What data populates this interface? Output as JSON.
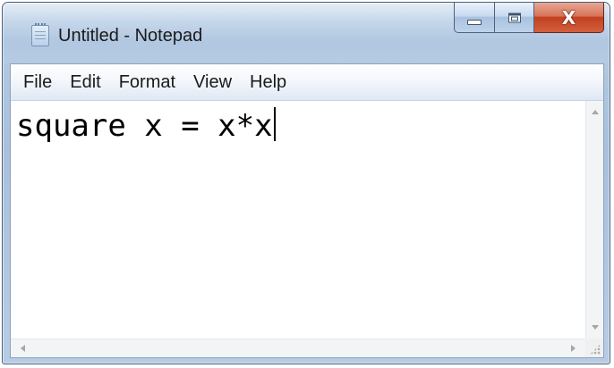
{
  "window": {
    "title": "Untitled - Notepad",
    "app_icon": "notepad-icon",
    "controls": {
      "minimize_icon": "minimize-icon",
      "maximize_icon": "maximize-icon",
      "close_glyph": "X"
    }
  },
  "menu": {
    "items": [
      {
        "label": "File"
      },
      {
        "label": "Edit"
      },
      {
        "label": "Format"
      },
      {
        "label": "View"
      },
      {
        "label": "Help"
      }
    ]
  },
  "editor": {
    "content": "square x = x*x"
  },
  "colors": {
    "titlebar": "#b3c9e2",
    "close_button": "#c2401f",
    "editor_background": "#ffffff",
    "text": "#000000"
  }
}
